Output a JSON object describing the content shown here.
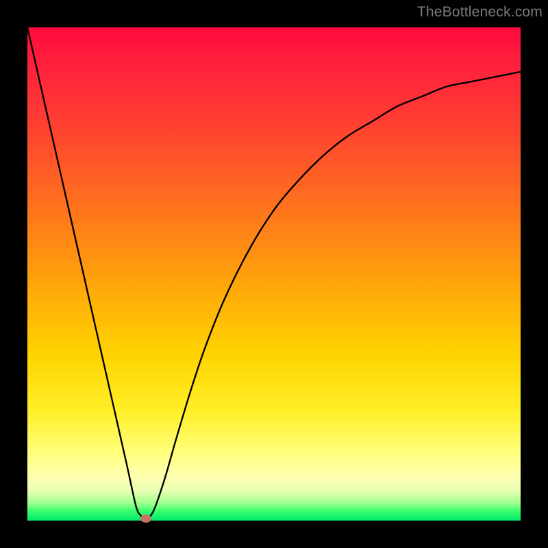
{
  "watermark": "TheBottleneck.com",
  "colors": {
    "frame": "#000000",
    "curve": "#000000",
    "marker": "#c57465",
    "gradient_top": "#ff0a3f",
    "gradient_bottom": "#00e96a"
  },
  "chart_data": {
    "type": "line",
    "title": "",
    "xlabel": "",
    "ylabel": "",
    "xlim": [
      0,
      100
    ],
    "ylim": [
      0,
      100
    ],
    "grid": false,
    "legend": false,
    "series": [
      {
        "name": "bottleneck-curve",
        "x": [
          0,
          5,
          10,
          15,
          20,
          22,
          23,
          24,
          25,
          26,
          28,
          30,
          33,
          36,
          40,
          45,
          50,
          55,
          60,
          65,
          70,
          75,
          80,
          85,
          90,
          95,
          100
        ],
        "y": [
          100,
          78,
          56,
          34,
          12,
          3,
          1,
          0,
          1,
          3,
          9,
          16,
          26,
          35,
          45,
          55,
          63,
          69,
          74,
          78,
          81,
          84,
          86,
          88,
          89,
          90,
          91
        ]
      }
    ],
    "annotations": [
      {
        "name": "min-point",
        "x": 24,
        "y": 0
      }
    ]
  }
}
